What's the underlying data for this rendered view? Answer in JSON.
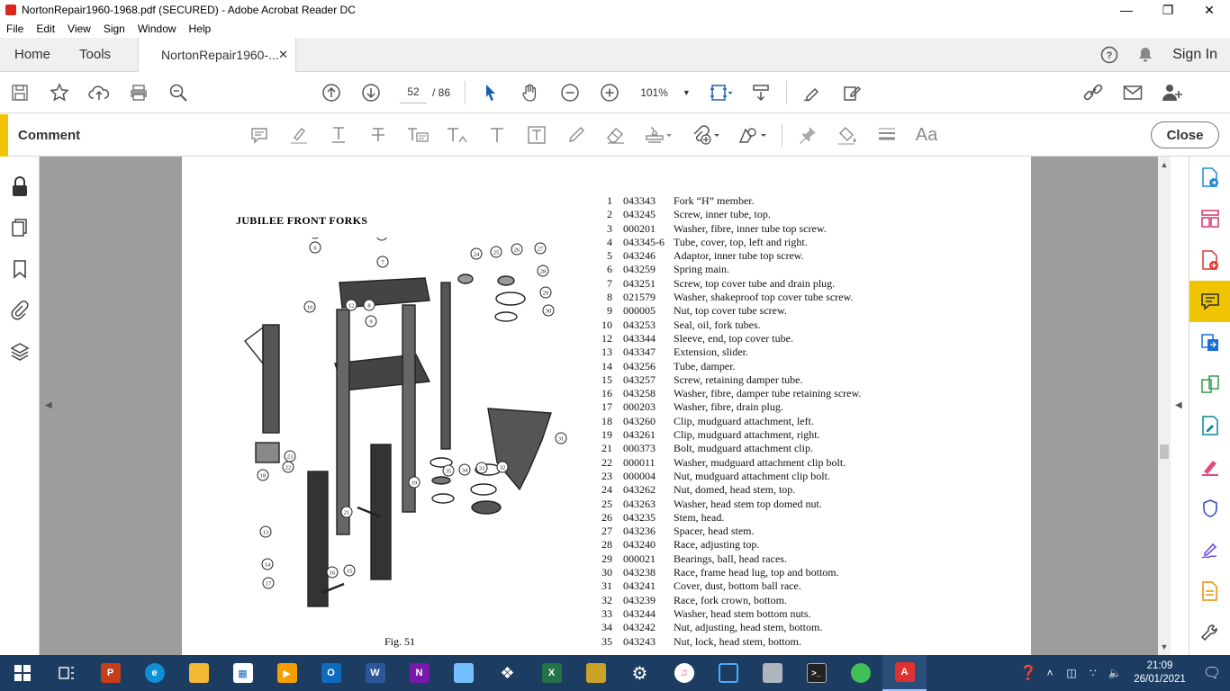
{
  "window": {
    "title": "NortonRepair1960-1968.pdf (SECURED) - Adobe Acrobat Reader DC"
  },
  "menu": [
    "File",
    "Edit",
    "View",
    "Sign",
    "Window",
    "Help"
  ],
  "tabs": {
    "home": "Home",
    "tools": "Tools",
    "document": "NortonRepair1960-...",
    "sign_in": "Sign In"
  },
  "toolbar": {
    "page_current": "52",
    "page_total": "/ 86",
    "zoom": "101%"
  },
  "comment": {
    "label": "Comment",
    "close": "Close",
    "text_tool": "Aa"
  },
  "pdf": {
    "heading": "JUBILEE FRONT FORKS",
    "figure": "Fig. 51",
    "parts": [
      {
        "n": "1",
        "pn": "043343",
        "d": "Fork “H” member."
      },
      {
        "n": "2",
        "pn": "043245",
        "d": "Screw, inner tube, top."
      },
      {
        "n": "3",
        "pn": "000201",
        "d": "Washer, fibre, inner tube top screw."
      },
      {
        "n": "4",
        "pn": "043345-6",
        "d": "Tube, cover, top, left and right."
      },
      {
        "n": "5",
        "pn": "043246",
        "d": "Adaptor, inner tube top screw."
      },
      {
        "n": "6",
        "pn": "043259",
        "d": "Spring main."
      },
      {
        "n": "7",
        "pn": "043251",
        "d": "Screw, top cover tube and drain plug."
      },
      {
        "n": "8",
        "pn": "021579",
        "d": "Washer, shakeproof top cover tube screw."
      },
      {
        "n": "9",
        "pn": "000005",
        "d": "Nut, top cover tube screw."
      },
      {
        "n": "10",
        "pn": "043253",
        "d": "Seal, oil, fork tubes."
      },
      {
        "n": "12",
        "pn": "043344",
        "d": "Sleeve, end, top cover tube."
      },
      {
        "n": "13",
        "pn": "043347",
        "d": "Extension, slider."
      },
      {
        "n": "14",
        "pn": "043256",
        "d": "Tube, damper."
      },
      {
        "n": "15",
        "pn": "043257",
        "d": "Screw, retaining damper tube."
      },
      {
        "n": "16",
        "pn": "043258",
        "d": "Washer, fibre, damper tube retaining screw."
      },
      {
        "n": "17",
        "pn": "000203",
        "d": "Washer, fibre, drain plug."
      },
      {
        "n": "18",
        "pn": "043260",
        "d": "Clip, mudguard attachment, left."
      },
      {
        "n": "19",
        "pn": "043261",
        "d": "Clip, mudguard attachment, right."
      },
      {
        "n": "21",
        "pn": "000373",
        "d": "Bolt, mudguard attachment clip."
      },
      {
        "n": "22",
        "pn": "000011",
        "d": "Washer, mudguard attachment clip bolt."
      },
      {
        "n": "23",
        "pn": "000004",
        "d": "Nut, mudguard attachment clip bolt."
      },
      {
        "n": "24",
        "pn": "043262",
        "d": "Nut, domed, head stem, top."
      },
      {
        "n": "25",
        "pn": "043263",
        "d": "Washer, head stem top domed nut."
      },
      {
        "n": "26",
        "pn": "043235",
        "d": "Stem, head."
      },
      {
        "n": "27",
        "pn": "043236",
        "d": "Spacer, head stem."
      },
      {
        "n": "28",
        "pn": "043240",
        "d": "Race, adjusting top."
      },
      {
        "n": "29",
        "pn": "000021",
        "d": "Bearings, ball, head races."
      },
      {
        "n": "30",
        "pn": "043238",
        "d": "Race, frame head lug, top and bottom."
      },
      {
        "n": "31",
        "pn": "043241",
        "d": "Cover, dust, bottom ball race."
      },
      {
        "n": "32",
        "pn": "043239",
        "d": "Race, fork crown, bottom."
      },
      {
        "n": "33",
        "pn": "043244",
        "d": "Washer, head stem bottom nuts."
      },
      {
        "n": "34",
        "pn": "043242",
        "d": "Nut, adjusting, head stem, bottom."
      },
      {
        "n": "35",
        "pn": "043243",
        "d": "Nut, lock, head stem, bottom."
      }
    ],
    "callouts": [
      "1",
      "2",
      "3",
      "4",
      "5",
      "6",
      "7",
      "8",
      "9",
      "10",
      "12",
      "13",
      "14",
      "15",
      "16",
      "17",
      "18",
      "19",
      "21",
      "22",
      "23",
      "24",
      "25",
      "26",
      "27",
      "28",
      "29",
      "30",
      "31",
      "32",
      "33",
      "34",
      "35"
    ]
  },
  "taskbar": {
    "time": "21:09",
    "date": "26/01/2021"
  }
}
